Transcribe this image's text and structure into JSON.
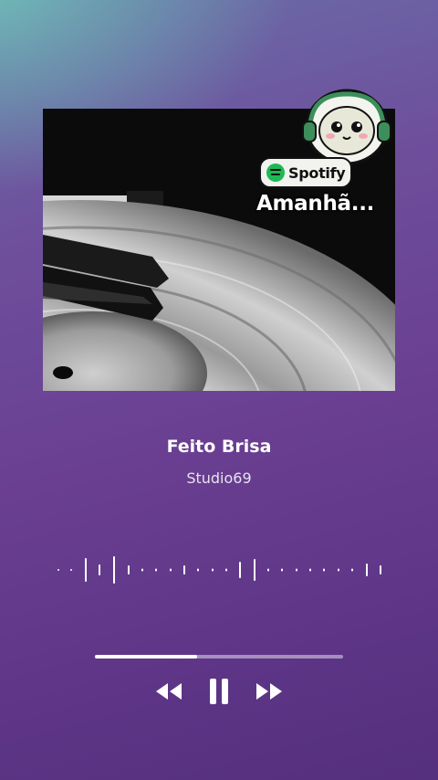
{
  "artwork": {
    "badge_text": "Spotify",
    "caption": "Amanhã..."
  },
  "track": {
    "title": "Feito Brisa",
    "artist": "Studio69"
  },
  "playback": {
    "progress": 0.41,
    "state": "playing"
  },
  "icons": {
    "rewind": "rewind-icon",
    "pause": "pause-icon",
    "forward": "fast-forward-icon"
  },
  "colors": {
    "accent": "#ffffff",
    "spotify_green": "#1db954",
    "background_top": "#6fc6b8",
    "background_bottom": "#55307e"
  }
}
